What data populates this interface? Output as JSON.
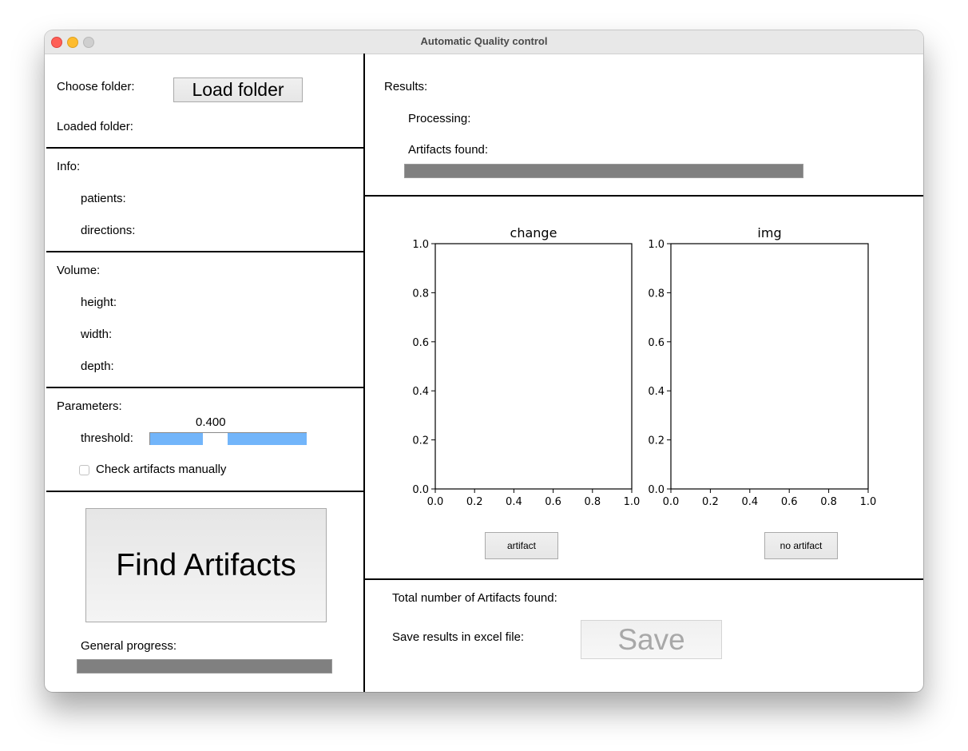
{
  "window": {
    "title": "Automatic Quality control"
  },
  "folder": {
    "choose_label": "Choose folder:",
    "load_button": "Load folder",
    "loaded_label": "Loaded folder:",
    "loaded_value": ""
  },
  "info": {
    "header": "Info:",
    "patients_label": "patients:",
    "directions_label": "directions:"
  },
  "volume": {
    "header": "Volume:",
    "height_label": "height:",
    "width_label": "width:",
    "depth_label": "depth:"
  },
  "parameters": {
    "header": "Parameters:",
    "threshold_label": "threshold:",
    "threshold_value": "0.400",
    "threshold_fraction": 0.4,
    "manual_check_label": "Check  artifacts manually",
    "manual_check_checked": false
  },
  "actions": {
    "find_button": "Find Artifacts",
    "general_progress_label": "General progress:",
    "general_progress": 0
  },
  "results": {
    "header": "Results:",
    "processing_label": "Processing:",
    "artifacts_found_label": "Artifacts found:",
    "artifacts_progress": 0
  },
  "review": {
    "artifact_button": "artifact",
    "no_artifact_button": "no artifact"
  },
  "summary": {
    "total_label": "Total number of Artifacts found:",
    "save_label": "Save results in excel file:",
    "save_button": "Save",
    "save_enabled": false
  },
  "chart_data": [
    {
      "type": "scatter",
      "title": "change",
      "xlabel": "",
      "ylabel": "",
      "xlim": [
        0.0,
        1.0
      ],
      "ylim": [
        0.0,
        1.0
      ],
      "xticks": [
        "0.0",
        "0.2",
        "0.4",
        "0.6",
        "0.8",
        "1.0"
      ],
      "yticks": [
        "0.0",
        "0.2",
        "0.4",
        "0.6",
        "0.8",
        "1.0"
      ],
      "series": [],
      "grid": false
    },
    {
      "type": "scatter",
      "title": "img",
      "xlabel": "",
      "ylabel": "",
      "xlim": [
        0.0,
        1.0
      ],
      "ylim": [
        0.0,
        1.0
      ],
      "xticks": [
        "0.0",
        "0.2",
        "0.4",
        "0.6",
        "0.8",
        "1.0"
      ],
      "yticks": [
        "0.0",
        "0.2",
        "0.4",
        "0.6",
        "0.8",
        "1.0"
      ],
      "series": [],
      "grid": false
    }
  ]
}
